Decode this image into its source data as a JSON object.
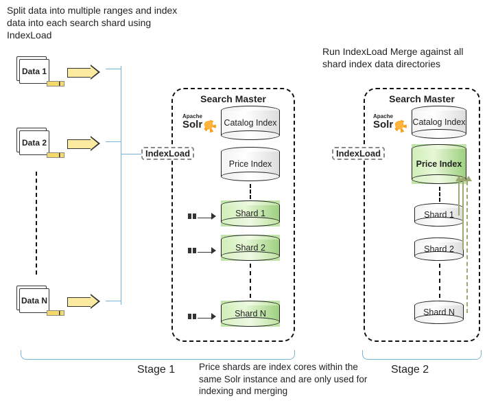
{
  "captions": {
    "topLeft": "Split data into multiple ranges and index data into each search shard using IndexLoad",
    "topRight": "Run IndexLoad Merge against all shard index data directories",
    "bottom": "Price shards are index cores within the same Solr instance and are only used for indexing and merging"
  },
  "dataItems": [
    "Data 1",
    "Data 2",
    "Data N"
  ],
  "stage1": {
    "title": "Search Master",
    "solr": "Solr",
    "solrPrefix": "Apache",
    "indexload": "IndexLoad",
    "cylinders": [
      "Catalog Index",
      "Price Index"
    ],
    "shards": [
      "Shard 1",
      "Shard 2",
      "Shard N"
    ]
  },
  "stage2": {
    "title": "Search Master",
    "solr": "Solr",
    "solrPrefix": "Apache",
    "indexload": "IndexLoad",
    "cylinders": [
      "Catalog Index",
      "Price Index"
    ],
    "shards": [
      "Shard 1",
      "Shard 2",
      "Shard N"
    ]
  },
  "stageLabels": {
    "s1": "Stage 1",
    "s2": "Stage 2"
  }
}
